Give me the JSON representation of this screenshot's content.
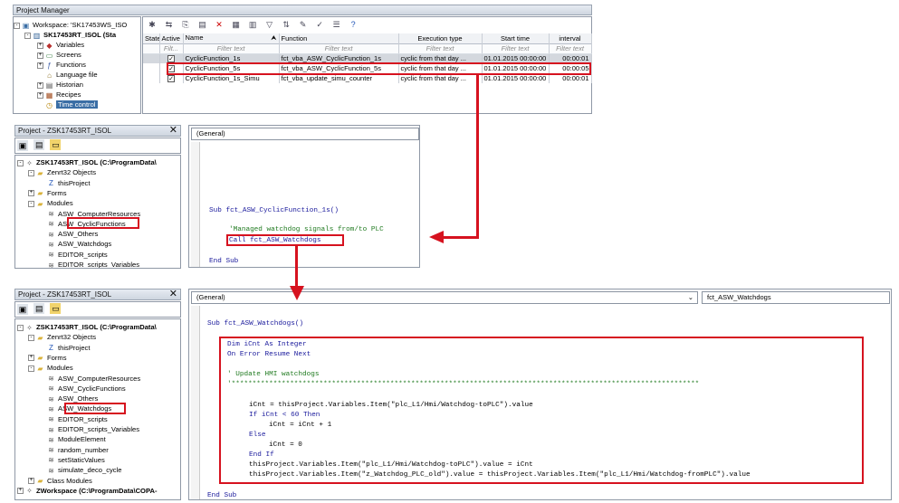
{
  "pm": {
    "title": "Project Manager",
    "tree": [
      {
        "label": "Workspace: 'SK17453WS_ISO",
        "icon": "workspace-icon",
        "exp": "-"
      },
      {
        "label": "SK17453RT_ISOL (Sta",
        "icon": "project-icon",
        "exp": "-"
      },
      {
        "label": "Variables",
        "icon": "variables-icon",
        "exp": "+"
      },
      {
        "label": "Screens",
        "icon": "screens-icon",
        "exp": "+"
      },
      {
        "label": "Functions",
        "icon": "functions-icon",
        "exp": "+"
      },
      {
        "label": "Language file",
        "icon": "language-icon",
        "exp": ""
      },
      {
        "label": "Historian",
        "icon": "historian-icon",
        "exp": "+"
      },
      {
        "label": "Recipes",
        "icon": "recipes-icon",
        "exp": "+"
      },
      {
        "label": "Time control",
        "icon": "clock-icon",
        "exp": ""
      }
    ],
    "columns": [
      "State",
      "Active",
      "Name",
      "Function",
      "Execution type",
      "Start time",
      "interval"
    ],
    "filter": [
      "Filt...",
      "Filter text",
      "Filter text",
      "Filter text",
      "Filter text",
      "Filter text"
    ],
    "rows": [
      {
        "name": "CyclicFunction_1s",
        "function": "fct_vba_ASW_CyclicFunction_1s",
        "exec": "cyclic from that day ...",
        "start": "01.01.2015 00:00:00",
        "interval": "00:00:01"
      },
      {
        "name": "CyclicFunction_5s",
        "function": "fct_vba_ASW_CyclicFunction_5s",
        "exec": "cyclic from that day ...",
        "start": "01.01.2015 00:00:00",
        "interval": "00:00:05"
      },
      {
        "name": "CyclicFunction_1s_Simu",
        "function": "fct_vba_update_simu_counter",
        "exec": "cyclic from that day ...",
        "start": "01.01.2015 00:00:00",
        "interval": "00:00:01"
      }
    ]
  },
  "vba1": {
    "title": "Project - ZSK17453RT_ISOL",
    "tree": [
      {
        "label": "ZSK17453RT_ISOL (C:\\ProgramData\\",
        "indent": 0,
        "exp": "-",
        "icon": "vbaproject-icon"
      },
      {
        "label": "Zenrt32 Objects",
        "indent": 1,
        "exp": "-",
        "icon": "folder-icon"
      },
      {
        "label": "thisProject",
        "indent": 2,
        "exp": "",
        "icon": "z-icon"
      },
      {
        "label": "Forms",
        "indent": 1,
        "exp": "+",
        "icon": "folder-icon"
      },
      {
        "label": "Modules",
        "indent": 1,
        "exp": "-",
        "icon": "folder-icon"
      },
      {
        "label": "ASW_ComputerResources",
        "indent": 2,
        "exp": "",
        "icon": "module-icon"
      },
      {
        "label": "ASW_CyclicFunctions",
        "indent": 2,
        "exp": "",
        "icon": "module-icon"
      },
      {
        "label": "ASW_Others",
        "indent": 2,
        "exp": "",
        "icon": "module-icon"
      },
      {
        "label": "ASW_Watchdogs",
        "indent": 2,
        "exp": "",
        "icon": "module-icon"
      },
      {
        "label": "EDITOR_scripts",
        "indent": 2,
        "exp": "",
        "icon": "module-icon"
      },
      {
        "label": "EDITOR_scripts_Variables",
        "indent": 2,
        "exp": "",
        "icon": "module-icon"
      }
    ],
    "combo": "(General)",
    "code": {
      "sub": "Sub fct_ASW_CyclicFunction_1s()",
      "comment": "'Managed watchdog signals from/to PLC",
      "call": "Call fct_ASW_Watchdogs",
      "end": "End Sub"
    }
  },
  "vba2": {
    "title": "Project - ZSK17453RT_ISOL",
    "tree": [
      {
        "label": "ZSK17453RT_ISOL (C:\\ProgramData\\",
        "indent": 0,
        "exp": "-",
        "icon": "vbaproject-icon"
      },
      {
        "label": "Zenrt32 Objects",
        "indent": 1,
        "exp": "-",
        "icon": "folder-icon"
      },
      {
        "label": "thisProject",
        "indent": 2,
        "exp": "",
        "icon": "z-icon"
      },
      {
        "label": "Forms",
        "indent": 1,
        "exp": "+",
        "icon": "folder-icon"
      },
      {
        "label": "Modules",
        "indent": 1,
        "exp": "-",
        "icon": "folder-icon"
      },
      {
        "label": "ASW_ComputerResources",
        "indent": 2,
        "exp": "",
        "icon": "module-icon"
      },
      {
        "label": "ASW_CyclicFunctions",
        "indent": 2,
        "exp": "",
        "icon": "module-icon"
      },
      {
        "label": "ASW_Others",
        "indent": 2,
        "exp": "",
        "icon": "module-icon"
      },
      {
        "label": "ASW_Watchdogs",
        "indent": 2,
        "exp": "",
        "icon": "module-icon"
      },
      {
        "label": "EDITOR_scripts",
        "indent": 2,
        "exp": "",
        "icon": "module-icon"
      },
      {
        "label": "EDITOR_scripts_Variables",
        "indent": 2,
        "exp": "",
        "icon": "module-icon"
      },
      {
        "label": "ModuleElement",
        "indent": 2,
        "exp": "",
        "icon": "module-icon"
      },
      {
        "label": "random_number",
        "indent": 2,
        "exp": "",
        "icon": "module-icon"
      },
      {
        "label": "setStaticValues",
        "indent": 2,
        "exp": "",
        "icon": "module-icon"
      },
      {
        "label": "simulate_deco_cycle",
        "indent": 2,
        "exp": "",
        "icon": "module-icon"
      },
      {
        "label": "Class Modules",
        "indent": 1,
        "exp": "+",
        "icon": "folder-icon"
      },
      {
        "label": "ZWorkspace (C:\\ProgramData\\COPA-",
        "indent": 0,
        "exp": "+",
        "icon": "vbaproject-icon"
      }
    ],
    "combo_left": "(General)",
    "combo_right": "fct_ASW_Watchdogs",
    "code": {
      "sub": "Sub fct_ASW_Watchdogs()",
      "l1": "Dim iCnt As Integer",
      "l2": "On Error Resume Next",
      "l3": "' Update HMI watchdogs",
      "l4": "'****************************************************************************************************************",
      "l5": "iCnt = thisProject.Variables.Item(\"plc_L1/Hmi/Watchdog-toPLC\").value",
      "l6": "If iCnt < 60 Then",
      "l7": "iCnt = iCnt + 1",
      "l8": "Else",
      "l9": "iCnt = 0",
      "l10": "End If",
      "l11": "thisProject.Variables.Item(\"plc_L1/Hmi/Watchdog-toPLC\").value = iCnt",
      "l12": "thisProject.Variables.Item(\"z_Watchdog_PLC_old\").value = thisProject.Variables.Item(\"plc_L1/Hmi/Watchdog-fromPLC\").value",
      "end": "End Sub"
    }
  },
  "colors": {
    "highlight": "#d6121f",
    "selection": "#3a6ea5"
  }
}
